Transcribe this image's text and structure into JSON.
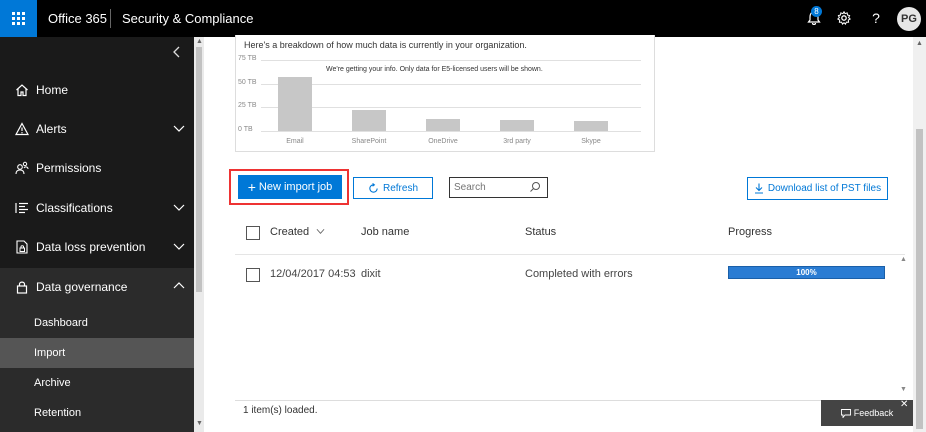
{
  "topbar": {
    "brand": "Office 365",
    "app_title": "Security & Compliance",
    "notification_count": "8",
    "help_label": "?",
    "avatar_initials": "PG"
  },
  "sidebar": {
    "items": [
      {
        "label": "Home",
        "icon": "home-icon"
      },
      {
        "label": "Alerts",
        "icon": "warning-icon"
      },
      {
        "label": "Permissions",
        "icon": "people-icon"
      },
      {
        "label": "Classifications",
        "icon": "list-icon"
      },
      {
        "label": "Data loss prevention",
        "icon": "document-lock-icon"
      },
      {
        "label": "Data governance",
        "icon": "lock-icon"
      }
    ],
    "sub_items": [
      {
        "label": "Dashboard"
      },
      {
        "label": "Import"
      },
      {
        "label": "Archive"
      },
      {
        "label": "Retention"
      }
    ]
  },
  "overview": {
    "description": "Here's a breakdown of how much data is currently in your organization.",
    "notice": "We're getting your info. Only data for E5-licensed users will be shown.",
    "chart_data": {
      "type": "bar",
      "categories": [
        "Email",
        "SharePoint",
        "OneDrive",
        "3rd party",
        "Skype"
      ],
      "values": [
        57,
        22,
        13,
        12,
        11
      ],
      "yticks": [
        "75 TB",
        "50 TB",
        "25 TB",
        "0 TB"
      ],
      "ylim": [
        0,
        75
      ]
    }
  },
  "toolbar": {
    "new_import_label": "New import job",
    "refresh_label": "Refresh",
    "search_placeholder": "Search",
    "download_label": "Download list of PST files"
  },
  "table": {
    "headers": {
      "created": "Created",
      "job_name": "Job name",
      "status": "Status",
      "progress": "Progress"
    },
    "rows": [
      {
        "created": "12/04/2017 04:53",
        "job_name": "dixit",
        "status": "Completed with errors",
        "progress_label": "100%",
        "progress_value": 100
      }
    ],
    "footer": "1 item(s) loaded."
  },
  "feedback": {
    "label": "Feedback"
  },
  "colors": {
    "accent": "#0078d7",
    "highlight": "#ee3333"
  }
}
